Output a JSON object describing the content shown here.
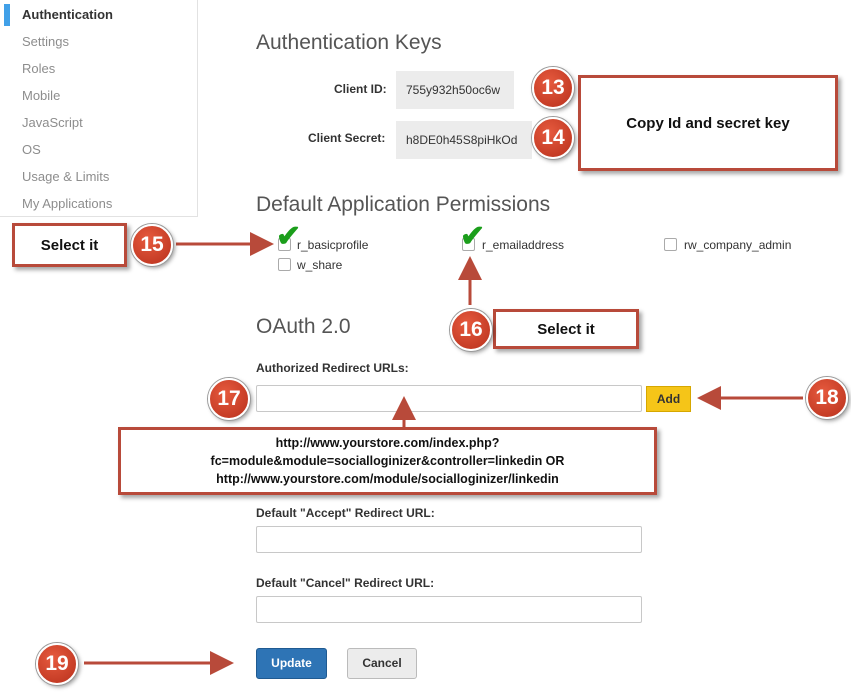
{
  "sidebar": {
    "items": [
      {
        "label": "Authentication"
      },
      {
        "label": "Settings"
      },
      {
        "label": "Roles"
      },
      {
        "label": "Mobile"
      },
      {
        "label": "JavaScript"
      },
      {
        "label": "OS"
      },
      {
        "label": "Usage & Limits"
      },
      {
        "label": "My Applications"
      }
    ]
  },
  "auth_keys": {
    "title": "Authentication Keys",
    "client_id_label": "Client ID:",
    "client_id_value": "755y932h50oc6w",
    "client_secret_label": "Client Secret:",
    "client_secret_value": "h8DE0h45S8piHkOd"
  },
  "permissions": {
    "title": "Default Application Permissions",
    "items": [
      {
        "label": "r_basicprofile",
        "checked": true
      },
      {
        "label": "r_emailaddress",
        "checked": true
      },
      {
        "label": "rw_company_admin",
        "checked": false
      },
      {
        "label": "w_share",
        "checked": false
      }
    ]
  },
  "oauth": {
    "title": "OAuth 2.0",
    "redirect_label": "Authorized Redirect URLs:",
    "add_button": "Add",
    "accept_label": "Default \"Accept\" Redirect URL:",
    "cancel_label": "Default \"Cancel\" Redirect URL:"
  },
  "actions": {
    "update": "Update",
    "cancel": "Cancel"
  },
  "annotations": {
    "copy_note": "Copy Id and secret key",
    "select_note_1": "Select it",
    "select_note_2": "Select it",
    "url_note": [
      "http://www.yourstore.com/index.php?",
      "fc=module&module=socialloginizer&controller=linkedin OR",
      "http://www.yourstore.com/module/socialloginizer/linkedin"
    ],
    "badges": [
      "13",
      "14",
      "15",
      "16",
      "17",
      "18",
      "19"
    ],
    "accent_color": "#b84a3a"
  }
}
